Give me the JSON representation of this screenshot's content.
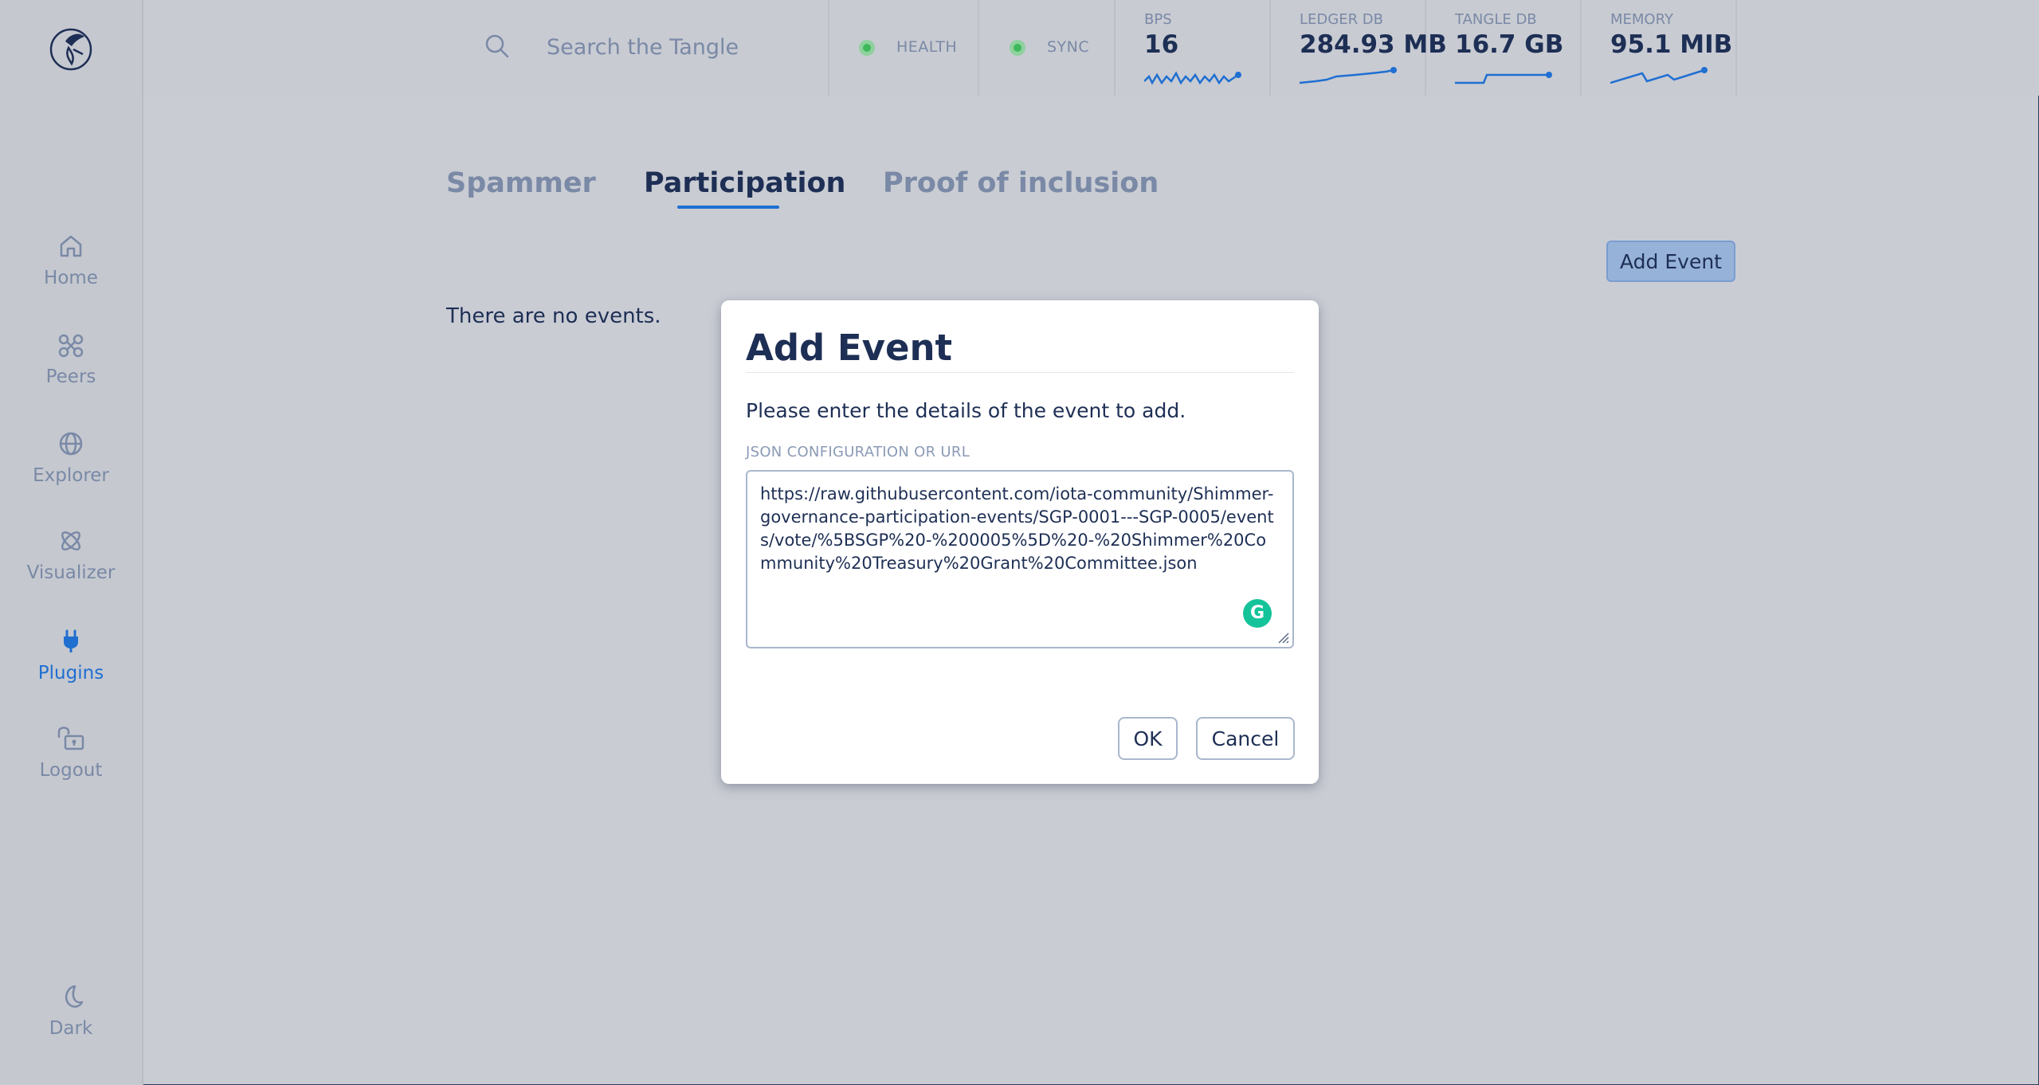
{
  "sidebar": {
    "items": [
      {
        "label": "Home",
        "icon": "home-icon",
        "active": false
      },
      {
        "label": "Peers",
        "icon": "peers-icon",
        "active": false
      },
      {
        "label": "Explorer",
        "icon": "globe-icon",
        "active": false
      },
      {
        "label": "Visualizer",
        "icon": "atom-icon",
        "active": false
      },
      {
        "label": "Plugins",
        "icon": "plug-icon",
        "active": true
      },
      {
        "label": "Logout",
        "icon": "lock-icon",
        "active": false
      }
    ],
    "theme_toggle": {
      "label": "Dark",
      "icon": "moon-icon"
    }
  },
  "header": {
    "search_placeholder": "Search the Tangle",
    "health_label": "HEALTH",
    "sync_label": "SYNC",
    "metrics": [
      {
        "label": "BPS",
        "value": "16"
      },
      {
        "label": "LEDGER DB",
        "value": "284.93 MB"
      },
      {
        "label": "TANGLE DB",
        "value": "16.7 GB"
      },
      {
        "label": "MEMORY",
        "value": "95.1 MIB"
      }
    ]
  },
  "tabs": [
    {
      "label": "Spammer",
      "active": false
    },
    {
      "label": "Participation",
      "active": true
    },
    {
      "label": "Proof of inclusion",
      "active": false
    }
  ],
  "main": {
    "add_event_label": "Add Event",
    "empty_text": "There are no events."
  },
  "dialog": {
    "title": "Add Event",
    "description": "Please enter the details of the event to add.",
    "field_label": "JSON CONFIGURATION OR URL",
    "field_value": "https://raw.githubusercontent.com/iota-community/Shimmer-governance-participation-events/SGP-0001---SGP-0005/events/vote/%5BSGP%20-%200005%5D%20-%20Shimmer%20Community%20Treasury%20Grant%20Committee.json",
    "ok_label": "OK",
    "cancel_label": "Cancel"
  },
  "colors": {
    "accent": "#1f6fd1",
    "status_ok": "#3fb85c",
    "grammarly": "#15c39a"
  }
}
